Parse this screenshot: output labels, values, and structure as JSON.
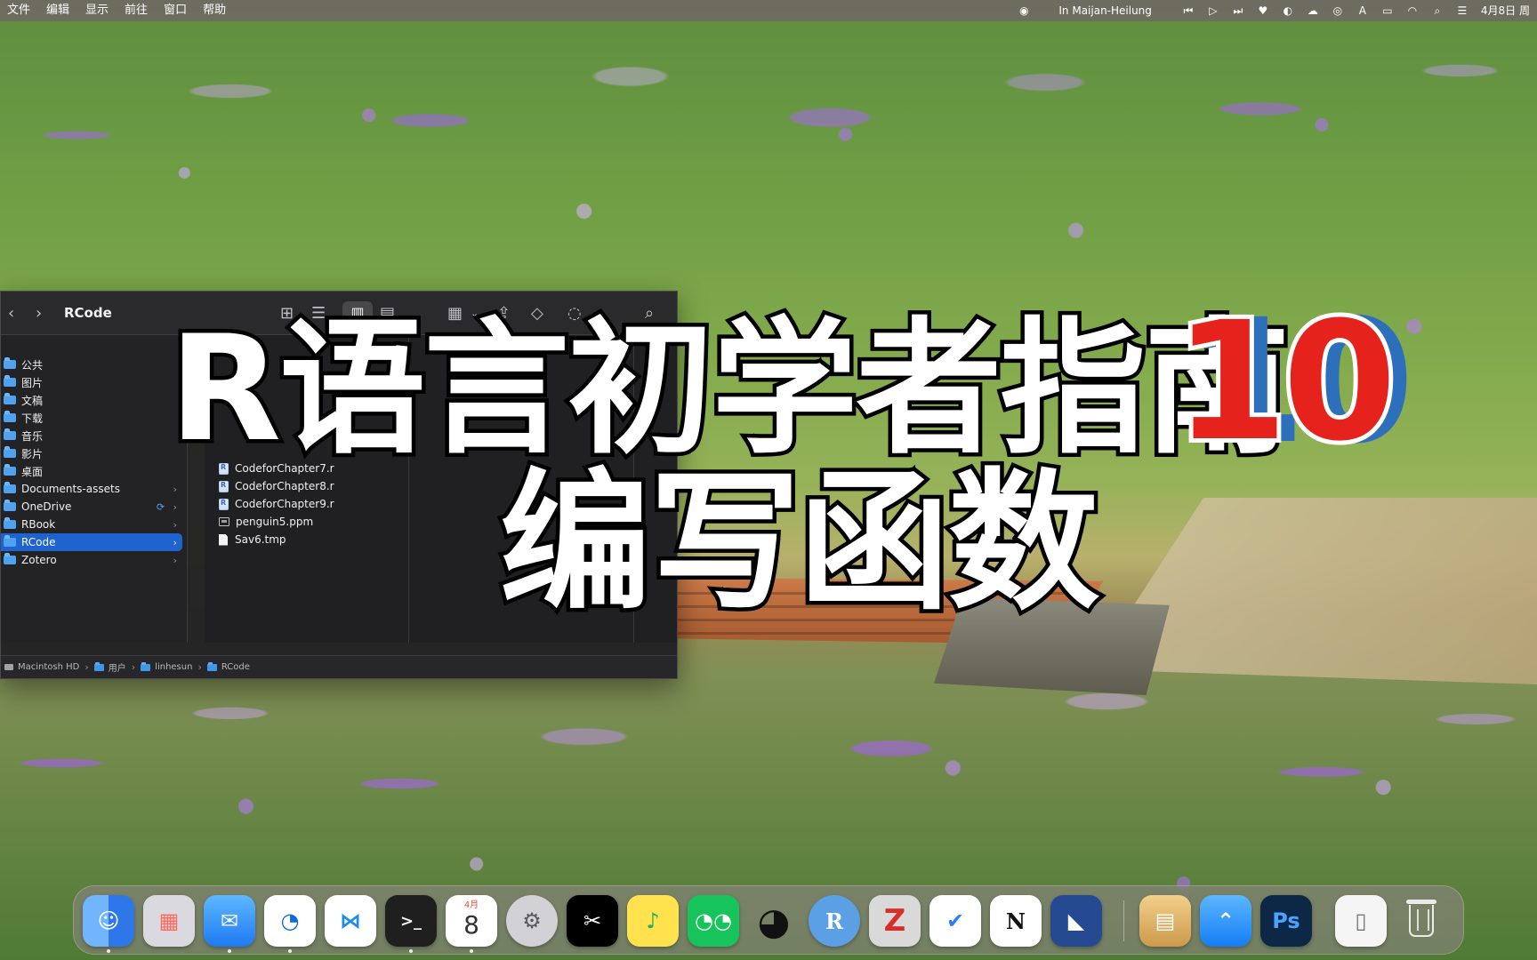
{
  "menu": {
    "left": [
      "文件",
      "编辑",
      "显示",
      "前往",
      "窗口",
      "帮助"
    ],
    "now_playing": "In Maijan-Heilung",
    "date_partial": "4月8日 周"
  },
  "finder": {
    "title": "RCode",
    "sidebar": [
      {
        "label": "公共"
      },
      {
        "label": "图片"
      },
      {
        "label": "文稿"
      },
      {
        "label": "下载"
      },
      {
        "label": "音乐"
      },
      {
        "label": "影片"
      },
      {
        "label": "桌面"
      },
      {
        "label": "Documents-assets",
        "arrow": "›"
      },
      {
        "label": "OneDrive",
        "arrow": "›"
      },
      {
        "label": "RBook",
        "arrow": "›"
      },
      {
        "label": "RCode",
        "arrow": "›"
      },
      {
        "label": "Zotero",
        "arrow": "›"
      }
    ],
    "files": [
      {
        "label": "CodeforChapter7.r"
      },
      {
        "label": "CodeforChapter8.r"
      },
      {
        "label": "CodeforChapter9.r"
      },
      {
        "label": "penguin5.ppm"
      },
      {
        "label": "Sav6.tmp"
      }
    ],
    "pathbar": [
      "Macintosh HD",
      "用户",
      "linhesun",
      "RCode"
    ]
  },
  "overlay": {
    "line1": "R语言初学者指南",
    "line2": "编写函数",
    "number": "10"
  },
  "dock": {
    "calendar_month": "4月",
    "calendar_day": "8",
    "r_label": "R",
    "z_label": "Z",
    "ps_label": "Ps",
    "notion_label": "N"
  },
  "colors": {
    "selection_blue": "#1f63d1",
    "folder_blue": "#4ea2f0",
    "overlay_red": "#e6221c",
    "overlay_blue": "#2e6fbc"
  }
}
